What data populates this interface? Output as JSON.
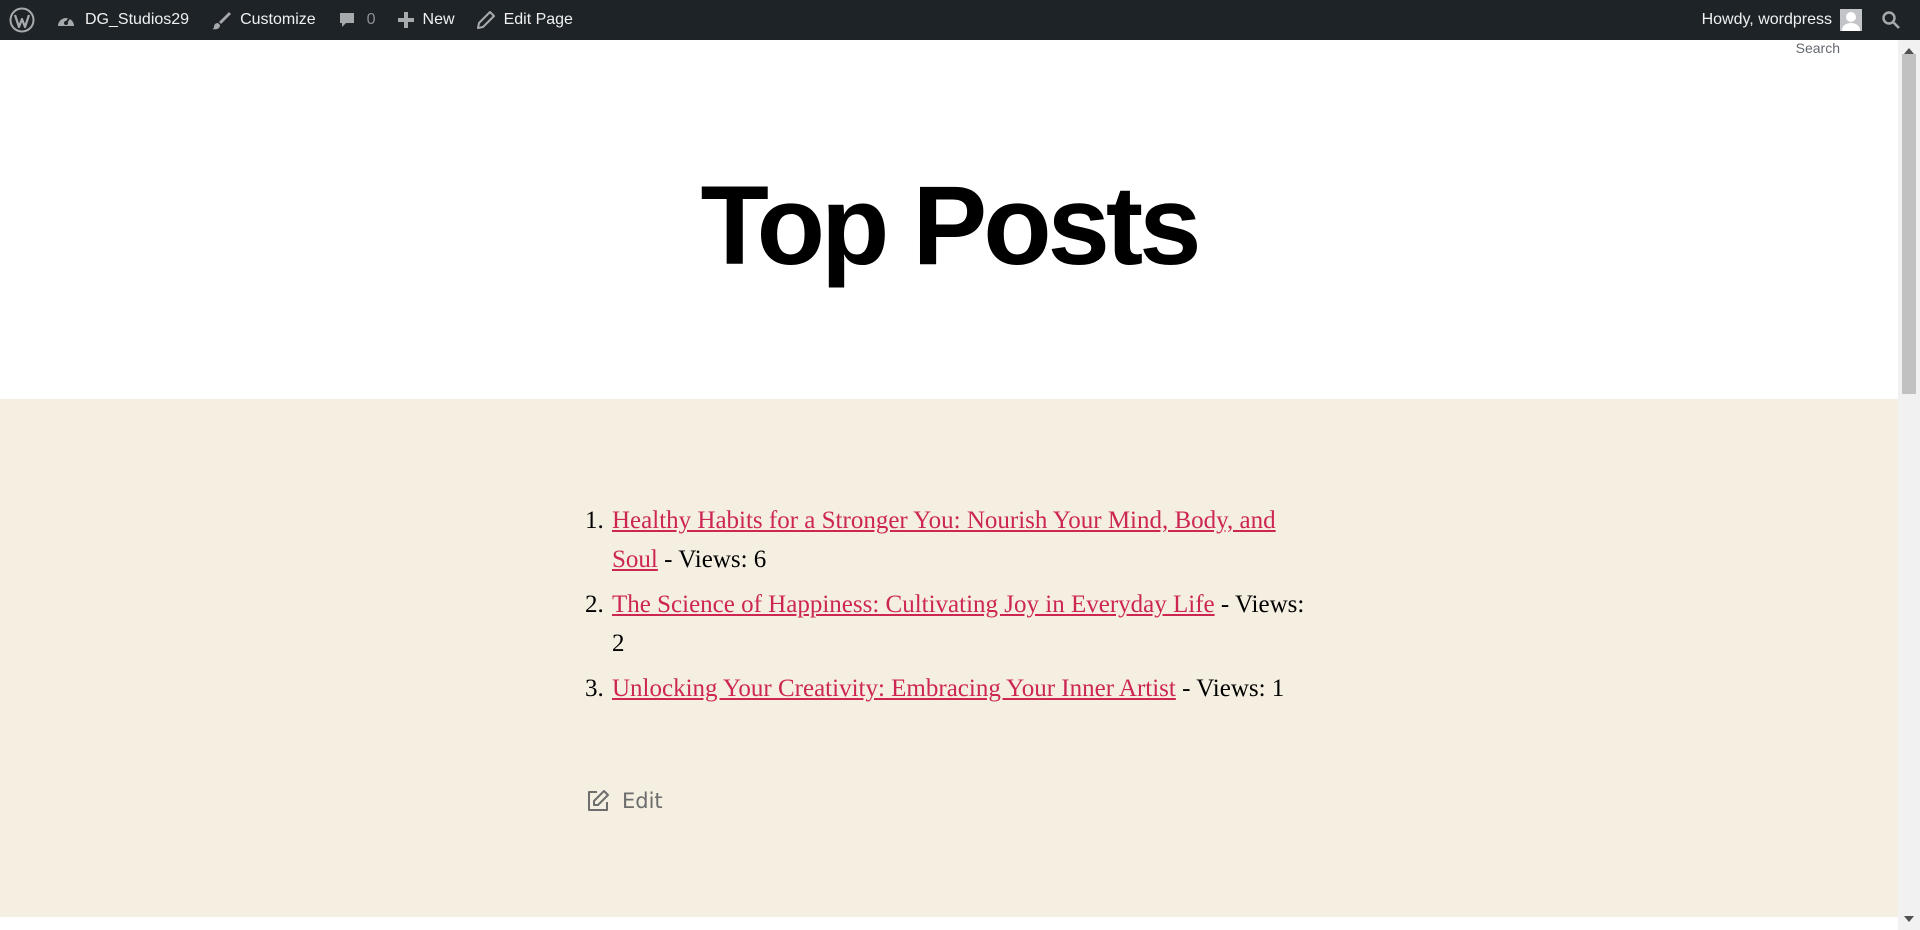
{
  "admin_bar": {
    "site_name": "DG_Studios29",
    "customize": "Customize",
    "comments_count": "0",
    "new": "New",
    "edit_page": "Edit Page",
    "howdy": "Howdy, wordpress"
  },
  "search_label": "Search",
  "page_title": "Top Posts",
  "posts": [
    {
      "num": "1.",
      "title": "Healthy Habits for a Stronger You: Nourish Your Mind, Body, and Soul",
      "views": " - Views: 6"
    },
    {
      "num": "2.",
      "title": "The Science of Happiness: Cultivating Joy in Everyday Life",
      "views": " - Views: 2"
    },
    {
      "num": "3.",
      "title": "Unlocking Your Creativity: Embracing Your Inner Artist",
      "views": " - Views: 1"
    }
  ],
  "edit_label": "Edit",
  "colors": {
    "admin_bar_bg": "#1d2327",
    "content_bg": "#f4efe1",
    "link": "#cd2653"
  }
}
